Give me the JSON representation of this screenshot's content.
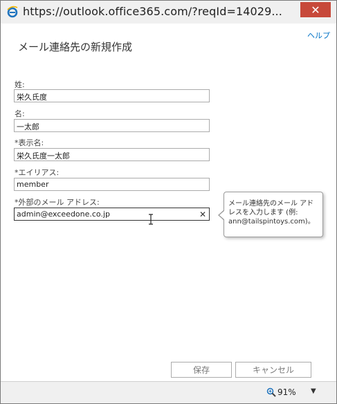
{
  "window": {
    "url": "https://outlook.office365.com/?reqId=14029...",
    "close_symbol": "✕"
  },
  "header": {
    "help_label": "ヘルプ",
    "title": "メール連絡先の新規作成"
  },
  "form": {
    "last_name": {
      "label": "姓:",
      "value": "栄久氏度"
    },
    "first_name": {
      "label": "名:",
      "value": "一太郎"
    },
    "display_name": {
      "label": "*表示名:",
      "value": "栄久氏度一太郎"
    },
    "alias": {
      "label": "*エイリアス:",
      "value": "member"
    },
    "external_email": {
      "label": "*外部のメール アドレス:",
      "value": "admin@exceedone.co.jp",
      "clear_symbol": "✕"
    }
  },
  "tooltip": {
    "text": "メール連絡先のメール アドレスを入力します (例: ann@tailspintoys.com)。"
  },
  "buttons": {
    "save_label": "保存",
    "cancel_label": "キャンセル"
  },
  "statusbar": {
    "zoom_label": "91%",
    "dropdown_symbol": "▼"
  },
  "colors": {
    "close_button": "#c7493a",
    "link": "#0072c6"
  }
}
